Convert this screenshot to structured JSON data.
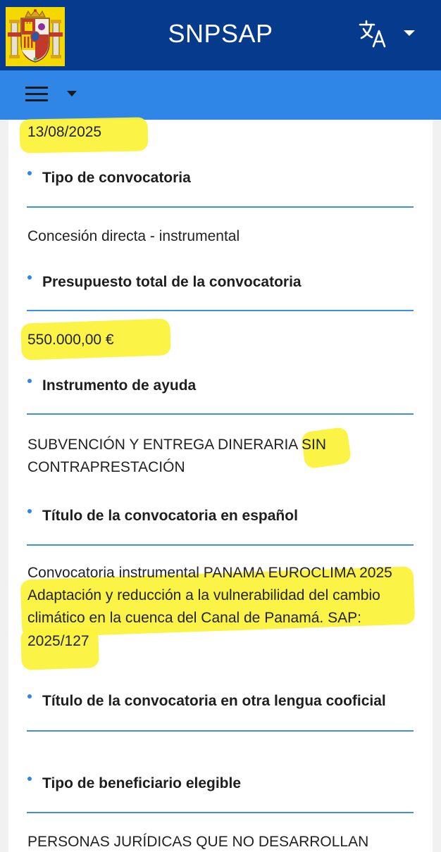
{
  "header": {
    "title": "SNPSAP"
  },
  "fields": {
    "fecha": "13/08/2025",
    "tipo_label": "Tipo de convocatoria",
    "tipo_value": "Concesión directa - instrumental",
    "presupuesto_label": "Presupuesto total de la convocatoria",
    "presupuesto_value": "550.000,00 €",
    "instrumento_label": "Instrumento de ayuda",
    "instrumento_value_1": "SUBVENCIÓN Y ENTREGA DINERARIA SIN",
    "instrumento_value_2": "CONTRAPRESTACIÓN",
    "titulo_es_label": "Título de la convocatoria en español",
    "titulo_es_value_1": "Convocatoria instrumental PANAMA EUROCLIMA 2025",
    "titulo_es_value_2": "Adaptación y reducción a la vulnerabilidad del cambio",
    "titulo_es_value_3": "climático en la cuenca del Canal de Panamá. SAP:",
    "titulo_es_value_4": "2025/127",
    "titulo_otra_label": "Título de la convocatoria en otra lengua cooficial",
    "beneficiario_label": "Tipo de beneficiario elegible",
    "beneficiario_value": "PERSONAS JURÍDICAS QUE NO DESARROLLAN"
  },
  "colors": {
    "header_bg": "#053a8c",
    "navbar_bg": "#2f86e6",
    "highlight": "#fbf23c",
    "divider": "#3f8fdf"
  },
  "icons": {
    "logo": "spain-coat-of-arms-icon",
    "language": "translate-icon",
    "menu": "hamburger-menu-icon"
  }
}
